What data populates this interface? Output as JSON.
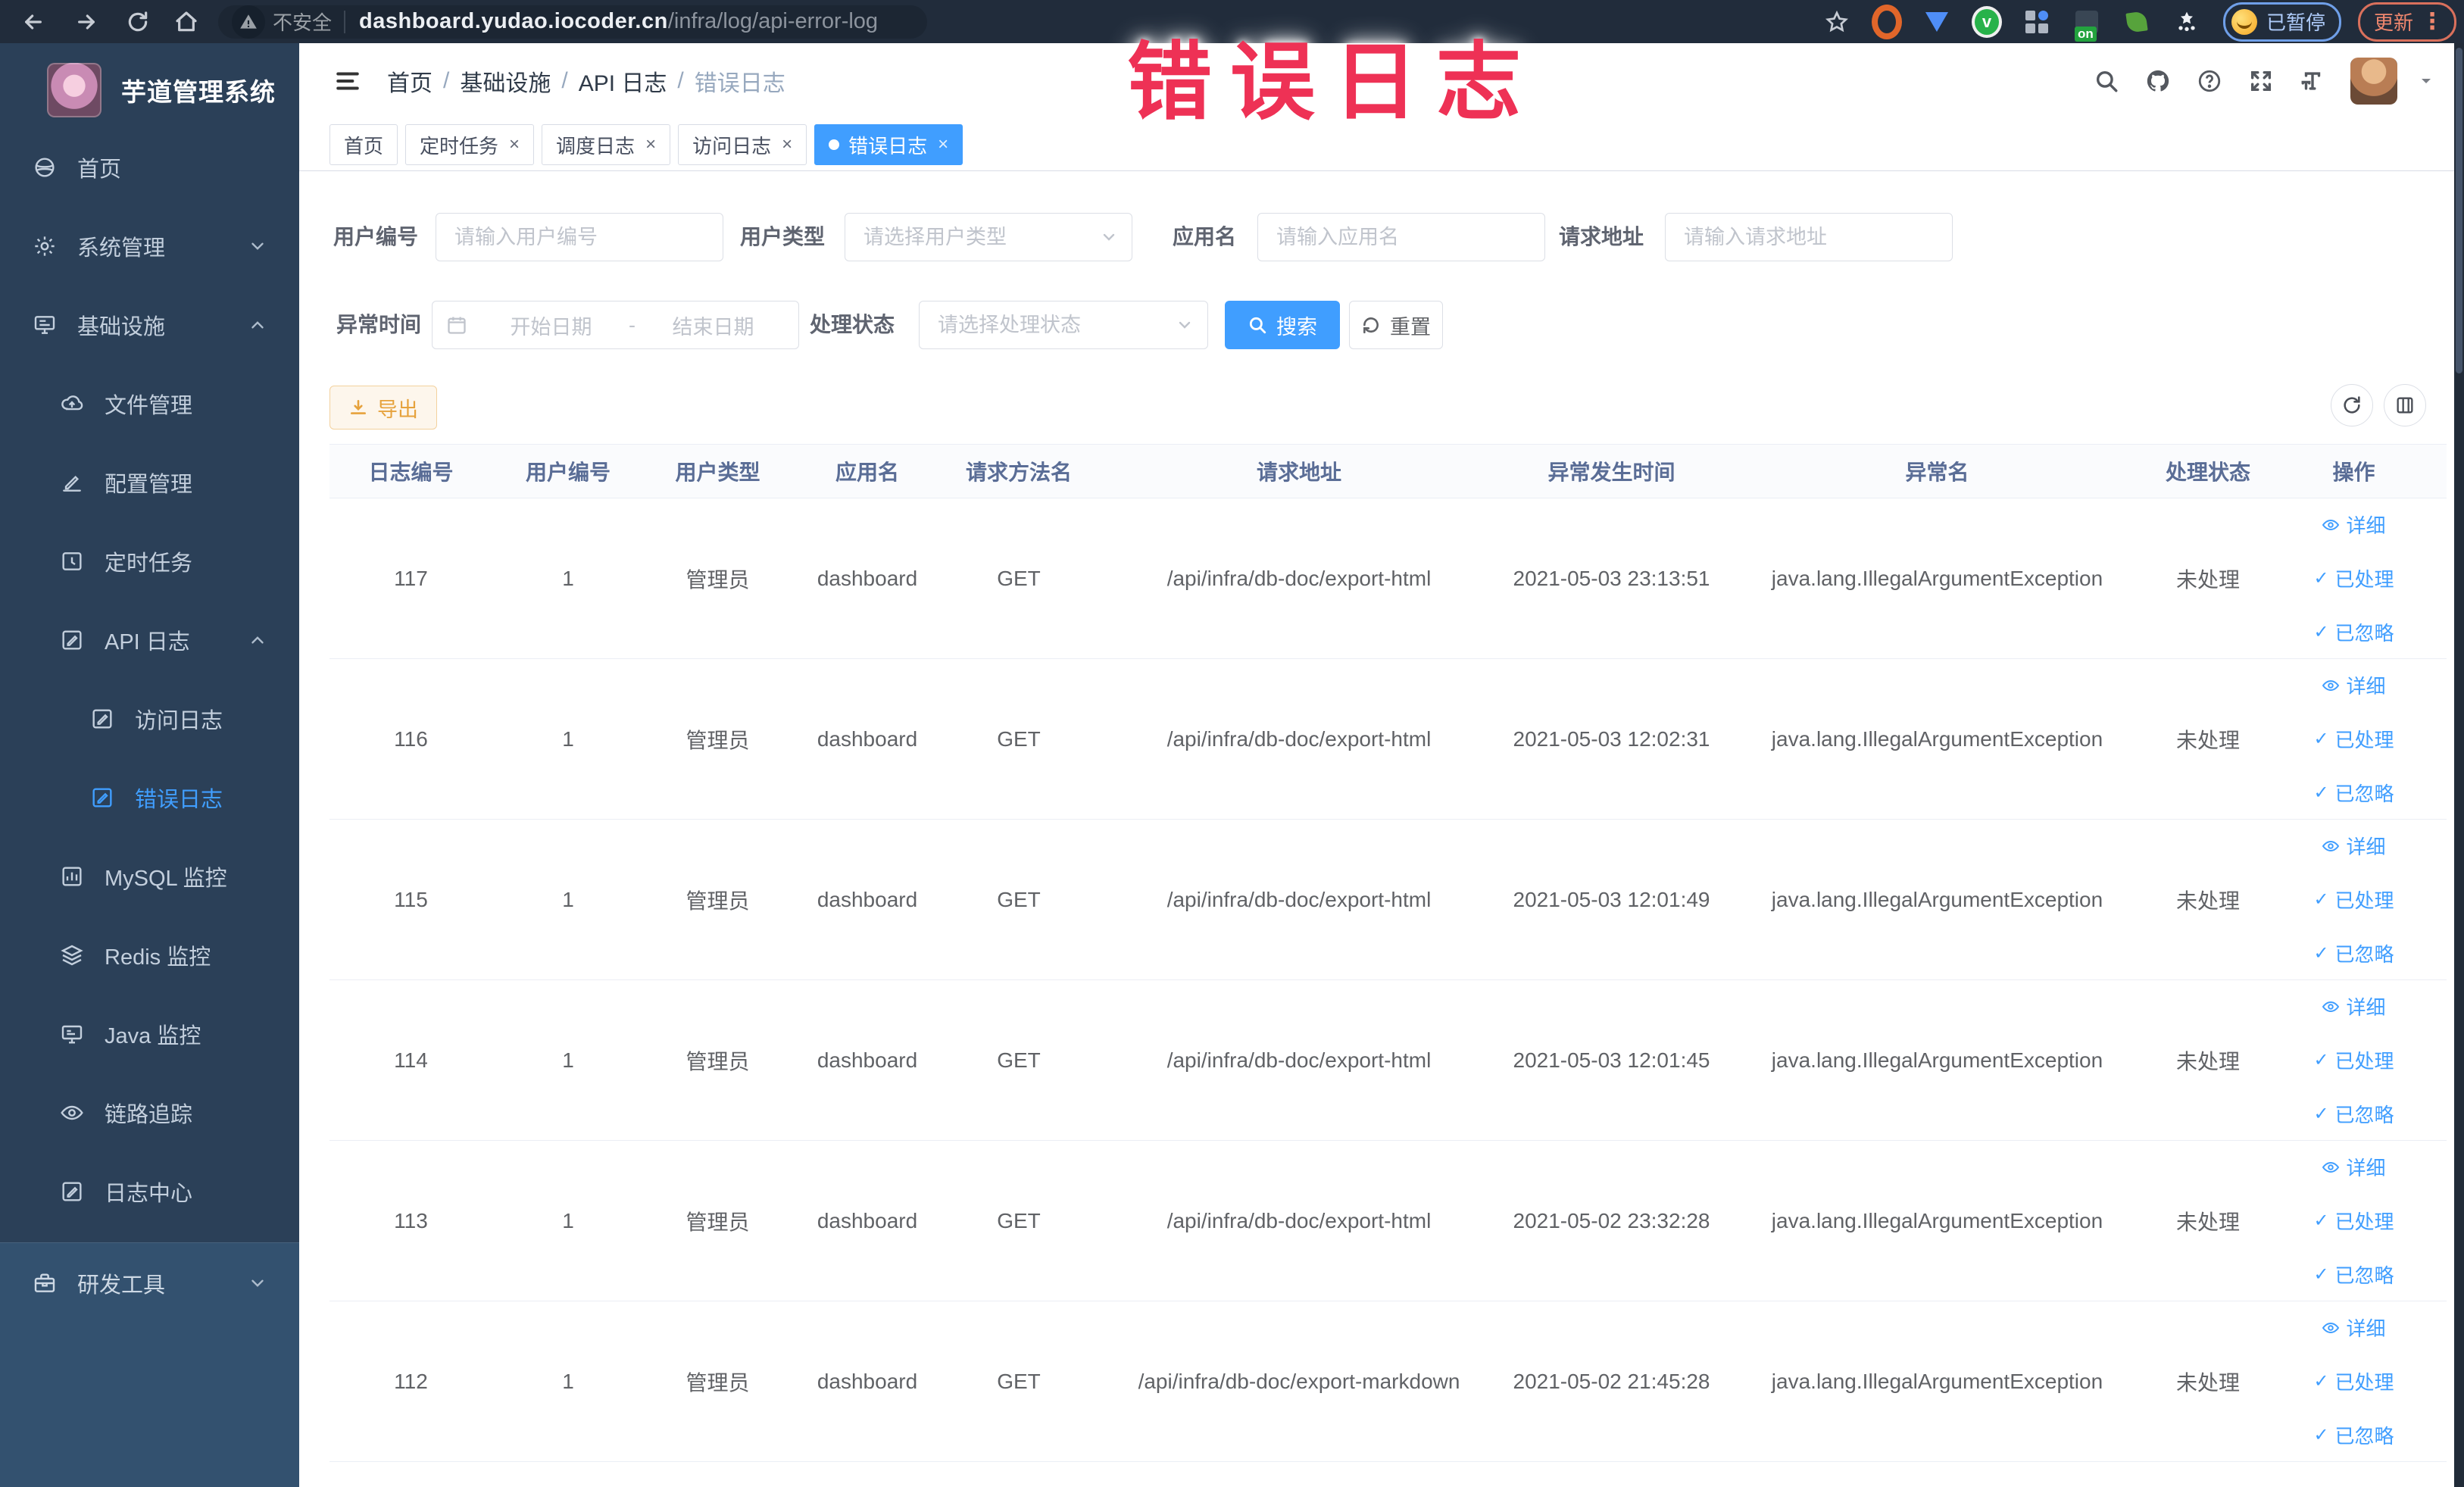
{
  "browser": {
    "security_label": "不安全",
    "url_domain": "dashboard.yudao.iocoder.cn",
    "url_path": "/infra/log/api-error-log",
    "profile_badge": "已暂停",
    "update_button": "更新",
    "extension_badge": "on"
  },
  "watermark": "错误日志",
  "sidebar": {
    "title": "芋道管理系统",
    "items": [
      {
        "label": "首页",
        "icon": "home-icon",
        "level": 0
      },
      {
        "label": "系统管理",
        "icon": "gear-icon",
        "level": 0,
        "chevron": "down"
      },
      {
        "label": "基础设施",
        "icon": "infra-icon",
        "level": 0,
        "chevron": "up"
      },
      {
        "label": "文件管理",
        "icon": "cloud-upload-icon",
        "level": 1
      },
      {
        "label": "配置管理",
        "icon": "config-edit-icon",
        "level": 1
      },
      {
        "label": "定时任务",
        "icon": "timer-icon",
        "level": 1
      },
      {
        "label": "API 日志",
        "icon": "log-edit-icon",
        "level": 1,
        "chevron": "up"
      },
      {
        "label": "访问日志",
        "icon": "log-edit-icon",
        "level": 2
      },
      {
        "label": "错误日志",
        "icon": "log-edit-icon",
        "level": 2,
        "active": true
      },
      {
        "label": "MySQL 监控",
        "icon": "chart-icon",
        "level": 1
      },
      {
        "label": "Redis 监控",
        "icon": "layers-icon",
        "level": 1
      },
      {
        "label": "Java 监控",
        "icon": "monitor-icon",
        "level": 1
      },
      {
        "label": "链路追踪",
        "icon": "eye-icon",
        "level": 1
      },
      {
        "label": "日志中心",
        "icon": "log-edit-icon",
        "level": 1
      }
    ],
    "bottom_item": {
      "label": "研发工具",
      "icon": "toolbox-icon",
      "chevron": "down"
    }
  },
  "navbar": {
    "breadcrumb": [
      "首页",
      "基础设施",
      "API 日志",
      "错误日志"
    ]
  },
  "tabs": [
    {
      "label": "首页",
      "closable": false,
      "active": false
    },
    {
      "label": "定时任务",
      "closable": true,
      "active": false
    },
    {
      "label": "调度日志",
      "closable": true,
      "active": false
    },
    {
      "label": "访问日志",
      "closable": true,
      "active": false
    },
    {
      "label": "错误日志",
      "closable": true,
      "active": true
    }
  ],
  "filters": {
    "user_id": {
      "label": "用户编号",
      "placeholder": "请输入用户编号"
    },
    "user_type": {
      "label": "用户类型",
      "placeholder": "请选择用户类型"
    },
    "app_name": {
      "label": "应用名",
      "placeholder": "请输入应用名"
    },
    "request_url": {
      "label": "请求地址",
      "placeholder": "请输入请求地址"
    },
    "exception_time": {
      "label": "异常时间",
      "start_placeholder": "开始日期",
      "separator": "-",
      "end_placeholder": "结束日期"
    },
    "process_status": {
      "label": "处理状态",
      "placeholder": "请选择处理状态"
    },
    "search_button": "搜索",
    "reset_button": "重置"
  },
  "toolbar": {
    "export_button": "导出"
  },
  "table": {
    "columns": [
      "日志编号",
      "用户编号",
      "用户类型",
      "应用名",
      "请求方法名",
      "请求地址",
      "异常发生时间",
      "异常名",
      "处理状态",
      "操作"
    ],
    "actions": [
      "详细",
      "已处理",
      "已忽略"
    ],
    "rows": [
      {
        "id": "117",
        "user_id": "1",
        "user_type": "管理员",
        "app": "dashboard",
        "method": "GET",
        "url": "/api/infra/db-doc/export-html",
        "time": "2021-05-03 23:13:51",
        "exception": "java.lang.IllegalArgumentException",
        "status": "未处理"
      },
      {
        "id": "116",
        "user_id": "1",
        "user_type": "管理员",
        "app": "dashboard",
        "method": "GET",
        "url": "/api/infra/db-doc/export-html",
        "time": "2021-05-03 12:02:31",
        "exception": "java.lang.IllegalArgumentException",
        "status": "未处理"
      },
      {
        "id": "115",
        "user_id": "1",
        "user_type": "管理员",
        "app": "dashboard",
        "method": "GET",
        "url": "/api/infra/db-doc/export-html",
        "time": "2021-05-03 12:01:49",
        "exception": "java.lang.IllegalArgumentException",
        "status": "未处理"
      },
      {
        "id": "114",
        "user_id": "1",
        "user_type": "管理员",
        "app": "dashboard",
        "method": "GET",
        "url": "/api/infra/db-doc/export-html",
        "time": "2021-05-03 12:01:45",
        "exception": "java.lang.IllegalArgumentException",
        "status": "未处理"
      },
      {
        "id": "113",
        "user_id": "1",
        "user_type": "管理员",
        "app": "dashboard",
        "method": "GET",
        "url": "/api/infra/db-doc/export-html",
        "time": "2021-05-02 23:32:28",
        "exception": "java.lang.IllegalArgumentException",
        "status": "未处理"
      },
      {
        "id": "112",
        "user_id": "1",
        "user_type": "管理员",
        "app": "dashboard",
        "method": "GET",
        "url": "/api/infra/db-doc/export-markdown",
        "time": "2021-05-02 21:45:28",
        "exception": "java.lang.IllegalArgumentException",
        "status": "未处理"
      }
    ]
  },
  "colors": {
    "accent": "#409eff",
    "watermark_pink": "#ee3155",
    "warning": "#e6a23c",
    "sidebar_bg": "#2b4058",
    "toolbar_bg": "#212c3b"
  }
}
